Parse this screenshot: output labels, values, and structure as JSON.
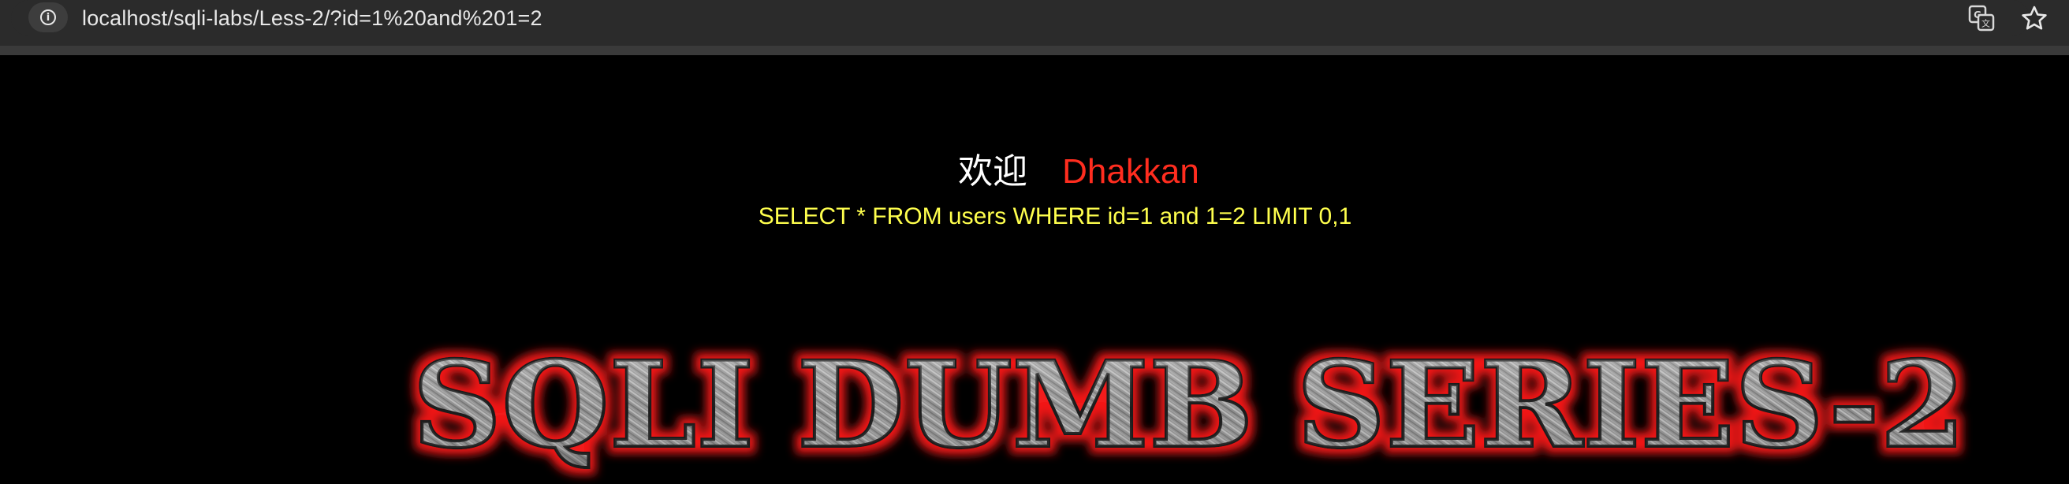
{
  "browser": {
    "url": "localhost/sqli-labs/Less-2/?id=1%20and%201=2",
    "icons": {
      "info": "info-icon",
      "translate": "translate-icon",
      "bookmark": "star-icon"
    }
  },
  "page": {
    "welcome_word": "欢迎",
    "welcome_name": "Dhakkan",
    "query": "SELECT * FROM users WHERE id=1 and 1=2 LIMIT 0,1",
    "banner_text": "SQLI DUMB SERIES-2"
  },
  "colors": {
    "background": "#000000",
    "welcome_word": "#ffffff",
    "welcome_name": "#ff2d1f",
    "query": "#ffff4d",
    "banner_glow": "#ff1a1a",
    "banner_fill": "#9a9a9a"
  }
}
